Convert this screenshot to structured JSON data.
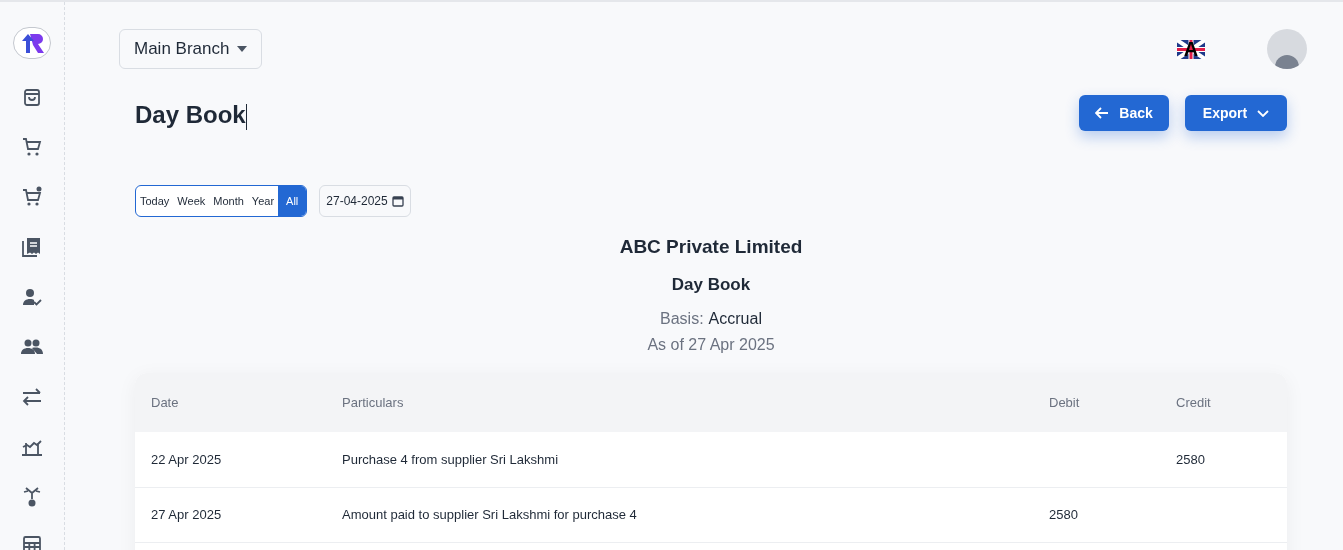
{
  "branch_select": {
    "value": "Main Branch"
  },
  "language_flag": {
    "label": "A"
  },
  "page_title": "Day Book",
  "actions": [
    {
      "kind": "back",
      "label": "Back"
    },
    {
      "kind": "export",
      "label": "Export"
    }
  ],
  "period_filter": [
    {
      "label": "Today",
      "selected": false
    },
    {
      "label": "Week",
      "selected": false
    },
    {
      "label": "Month",
      "selected": false
    },
    {
      "label": "Year",
      "selected": false
    },
    {
      "label": "All",
      "selected": true
    }
  ],
  "date_field": {
    "value": "27-04-2025"
  },
  "report": {
    "company": "ABC Private Limited",
    "title": "Day Book",
    "basis_label": "Basis:",
    "basis_value": "Accrual",
    "as_of": "As of 27 Apr 2025"
  },
  "table": {
    "columns": [
      "Date",
      "Particulars",
      "Debit",
      "Credit"
    ],
    "rows": [
      [
        "22 Apr 2025",
        "Purchase 4 from supplier Sri Lakshmi",
        "",
        "2580"
      ],
      [
        "27 Apr 2025",
        "Amount paid to supplier Sri Lakshmi for purchase 4",
        "2580",
        ""
      ]
    ]
  },
  "sidebar": {
    "items": [
      {
        "kind": "bag"
      },
      {
        "kind": "cart"
      },
      {
        "kind": "cart-plus"
      },
      {
        "kind": "receipt"
      },
      {
        "kind": "user-check"
      },
      {
        "kind": "users"
      },
      {
        "kind": "transfer"
      },
      {
        "kind": "chart"
      },
      {
        "kind": "plant"
      },
      {
        "kind": "calculator"
      }
    ]
  }
}
